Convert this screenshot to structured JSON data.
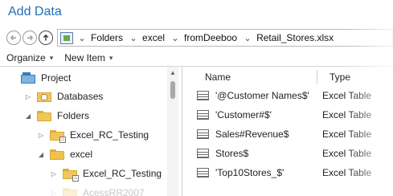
{
  "window": {
    "title": "Add Data"
  },
  "nav": {
    "back_icon": "back-arrow-icon",
    "forward_icon": "forward-arrow-icon",
    "up_icon": "up-arrow-icon"
  },
  "breadcrumb": {
    "items": [
      "Folders",
      "excel",
      "fromDeeboo",
      "Retail_Stores.xlsx"
    ]
  },
  "toolbar": {
    "organize_label": "Organize",
    "new_item_label": "New Item"
  },
  "tree": {
    "project_label": "Project",
    "databases_label": "Databases",
    "folders_label": "Folders",
    "excel_rc_testing_label": "Excel_RC_Testing",
    "excel_label": "excel",
    "excel_rc_testing_child_label": "Excel_RC_Testing",
    "partial_label": "AcessRR2007"
  },
  "list": {
    "columns": {
      "name": "Name",
      "type": "Type"
    },
    "rows": [
      {
        "name": "'@Customer Names$'",
        "type": "Excel Table"
      },
      {
        "name": "'Customer#$'",
        "type": "Excel Table"
      },
      {
        "name": "Sales#Revenue$",
        "type": "Excel Table"
      },
      {
        "name": "Stores$",
        "type": "Excel Table"
      },
      {
        "name": "'Top10Stores_$'",
        "type": "Excel Table"
      }
    ]
  },
  "colors": {
    "title": "#1f6fb5",
    "folder": "#f2c55c",
    "project": "#3a7bbf"
  }
}
